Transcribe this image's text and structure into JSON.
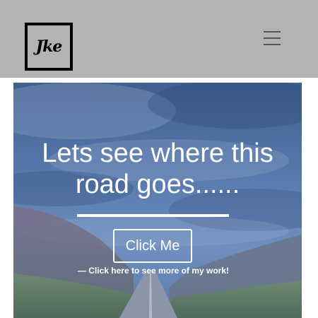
{
  "navbar": {
    "logo_text": "Jke",
    "menu_icon": "hamburger-menu-icon",
    "background": "#b3b3b4"
  },
  "hero": {
    "headline": "Lets see where this road goes......",
    "button_label": "Click Me",
    "subtext": "— Click here to see more of my work!",
    "overlay_color": "#4b6da0"
  }
}
